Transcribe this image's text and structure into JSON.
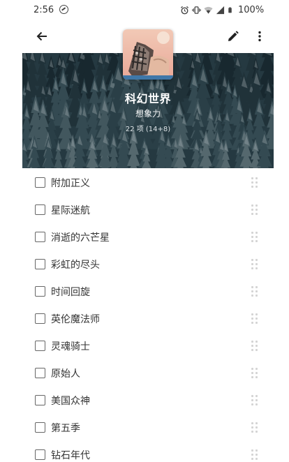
{
  "status_bar": {
    "time": "2:56",
    "icons": [
      "do-not-disturb-icon",
      "alarm-icon",
      "vibrate-icon",
      "wifi-icon",
      "cell-signal-icon",
      "battery-icon"
    ],
    "battery": "100%"
  },
  "app_bar": {
    "icons": [
      "back-arrow-icon",
      "pencil-icon",
      "more-vert-icon"
    ]
  },
  "header": {
    "title": "科幻世界",
    "subtitle": "想象力",
    "count": "22 项 (14+8)"
  },
  "items": [
    {
      "label": "附加正义",
      "checked": false
    },
    {
      "label": "星际迷航",
      "checked": false
    },
    {
      "label": "消逝的六芒星",
      "checked": false
    },
    {
      "label": "彩虹的尽头",
      "checked": false
    },
    {
      "label": "时间回旋",
      "checked": false
    },
    {
      "label": "英伦魔法师",
      "checked": false
    },
    {
      "label": "灵魂骑士",
      "checked": false
    },
    {
      "label": "原始人",
      "checked": false
    },
    {
      "label": "美国众神",
      "checked": false
    },
    {
      "label": "第五季",
      "checked": false
    },
    {
      "label": "钻石年代",
      "checked": false
    }
  ],
  "colors": {
    "forest_dark": "#1f3037",
    "forest_mid": "#3d545c",
    "text": "#333333",
    "checkbox_border": "#666666",
    "handle": "#d4d4d4"
  }
}
